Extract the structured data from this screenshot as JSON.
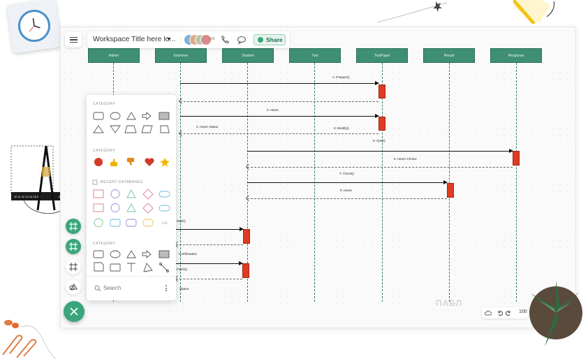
{
  "toolbar": {
    "workspace_title": "Workspace Title here lo...",
    "collaborator_count": "+26",
    "share_label": "Share"
  },
  "lifelines": [
    "Admin",
    "Examiner",
    "Student",
    "Test",
    "TestPaper",
    "Result",
    "Response"
  ],
  "messages": [
    {
      "label": "1:   Prepare()"
    },
    {
      "label": "2:   return"
    },
    {
      "label": "3:   Modify()"
    },
    {
      "label": "4:   return          Status"
    },
    {
      "label": "5:   Give()"
    },
    {
      "label": "6:   return          Choice"
    },
    {
      "label": "7:   Check()"
    },
    {
      "label": "8:   return"
    },
    {
      "label": "Start()"
    },
    {
      "label": "Confirmation"
    },
    {
      "label": "Finish()"
    },
    {
      "label": "Status"
    }
  ],
  "panel": {
    "category_1": "CATEGORY",
    "category_2": "CATEGORY",
    "recent_databases": "RECENT DATABASES",
    "category_3": "CATEGORY",
    "more_count": "+10",
    "search_placeholder": "Search"
  },
  "zoom": {
    "level": "100"
  },
  "watermark": "ПАБЛ",
  "colors": {
    "accent": "#3aa57a",
    "lifeline_header": "#3f8f74",
    "activation": "#e03a22"
  }
}
